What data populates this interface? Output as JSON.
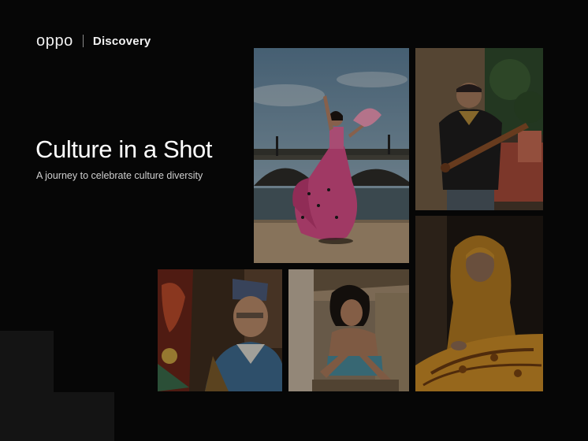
{
  "brand": {
    "primary_logo": "oppo",
    "partner_logo": "Discovery"
  },
  "hero": {
    "title": "Culture in a Shot",
    "subtitle": "A journey to celebrate culture diversity"
  },
  "colors": {
    "background": "#060606",
    "accent_pink": "#e0508a",
    "text": "#ffffff"
  }
}
